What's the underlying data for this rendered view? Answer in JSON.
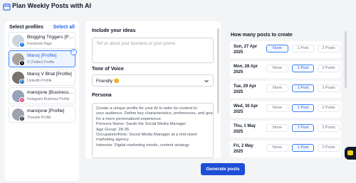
{
  "app": {
    "title": "Plan Weekly Posts with AI"
  },
  "profiles_panel": {
    "heading": "Select profiles",
    "select_all": "Select all",
    "items": [
      {
        "name": "Blogging Triggers [Page]",
        "platform": "Facebook Page",
        "badge_color": "#1877f2",
        "selected": false
      },
      {
        "name": "Manoj [Profile]",
        "platform": "X (Twitter) Profile",
        "badge_color": "#000000",
        "selected": true
      },
      {
        "name": "Manoj V Bhat [Profile]",
        "platform": "LinkedIn Profile",
        "badge_color": "#0a66c2",
        "selected": false
      },
      {
        "name": "manojone [Business Pro...",
        "platform": "Instagram Business Profile",
        "badge_color": "#e1306c",
        "selected": false
      },
      {
        "name": "manojone [Profile]",
        "platform": "Threads Profile",
        "badge_color": "#000000",
        "selected": false
      }
    ]
  },
  "form": {
    "ideas_label": "Include your ideas",
    "ideas_placeholder": "Tell us about your business or your promo.",
    "tone_label": "Tone of Voice",
    "tone_value": "Friendly 😊",
    "persona_label": "Persona",
    "persona_lines": [
      "Create a unique profile for your AI to tailor its content to",
      "your audience. Define key characteristics, preferences, and goals",
      "for a more personalized experience.",
      "Persona Name: Sarah the Social Media Manager",
      "Age Group: 28-35",
      "Occupation/Role: Social Media Manager at a mid-sized",
      "marketing agency",
      "Interests: Digital marketing trends, content strategy"
    ]
  },
  "schedule": {
    "heading": "How many posts to create",
    "option_labels": [
      "None",
      "1 Post",
      "2 Posts"
    ],
    "days": [
      {
        "date_line1": "Sun, 27 Apr",
        "date_line2": "2025",
        "selected": 0
      },
      {
        "date_line1": "Mon, 28 Apr",
        "date_line2": "2025",
        "selected": 1
      },
      {
        "date_line1": "Tue, 29 Apr",
        "date_line2": "2025",
        "selected": 1
      },
      {
        "date_line1": "Wed, 30 Apr",
        "date_line2": "2025",
        "selected": 1
      },
      {
        "date_line1": "Thu, 1 May",
        "date_line2": "2025",
        "selected": 1
      },
      {
        "date_line1": "Fri, 2 May",
        "date_line2": "2025",
        "selected": 1
      }
    ]
  },
  "actions": {
    "generate_label": "Generate posts"
  },
  "colors": {
    "accent": "#1d4ed8",
    "selected_border": "#3b82f6",
    "chat_icon": "#facc15"
  },
  "icons": {
    "title": "calendar-icon",
    "tone": "chevron-down-icon",
    "chat": "chat-icon",
    "check": "check-icon"
  }
}
